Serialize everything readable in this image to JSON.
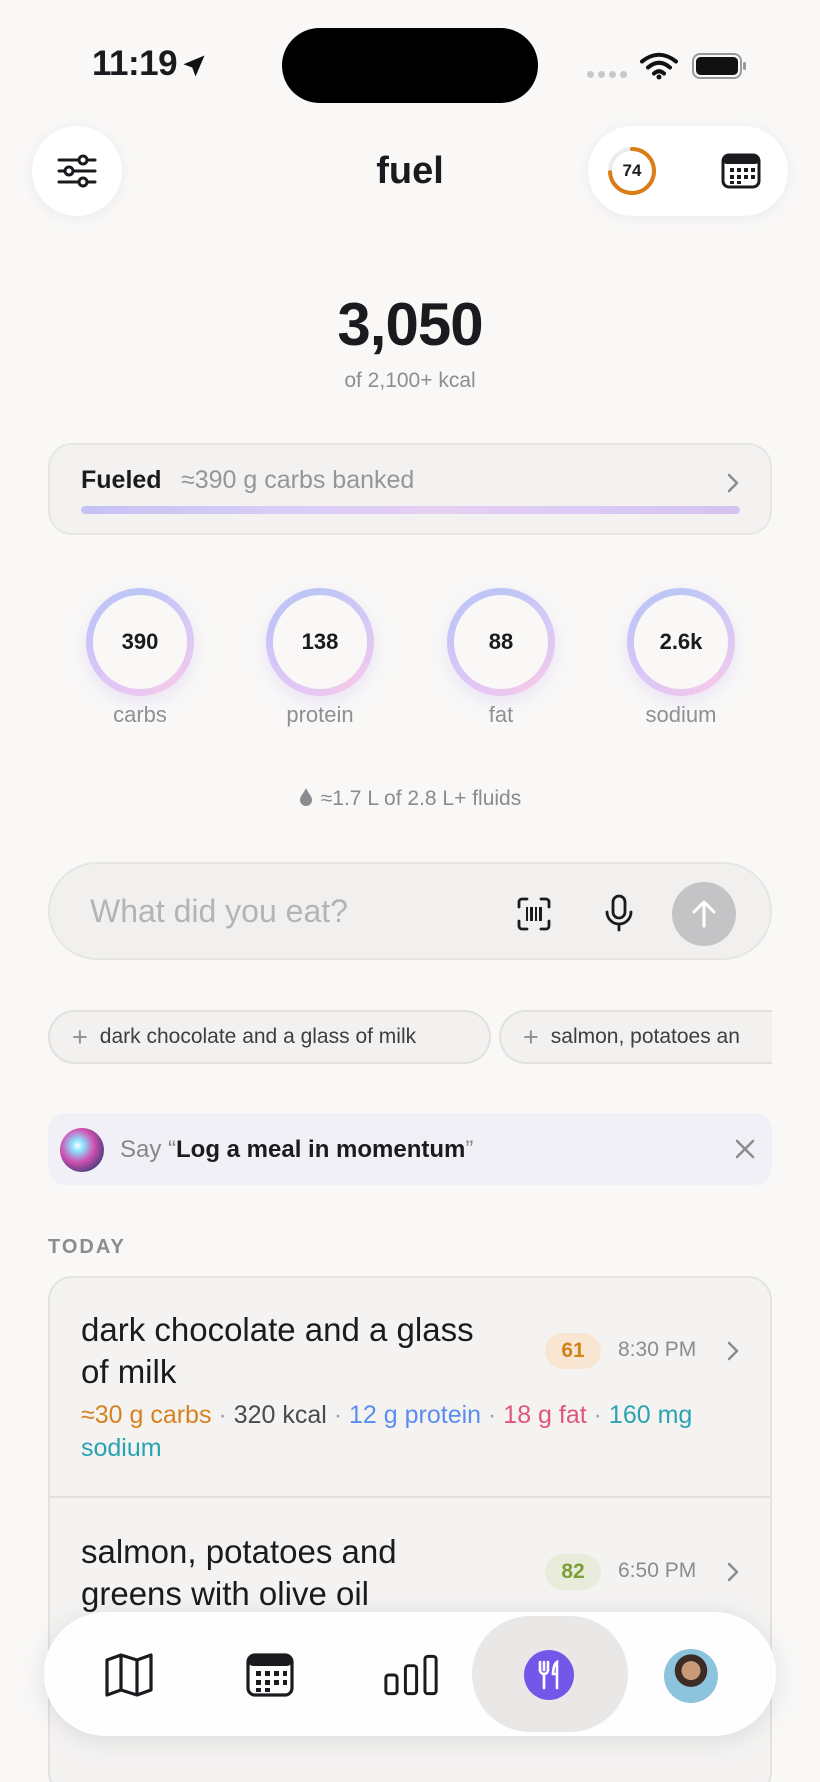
{
  "status": {
    "time": "11:19"
  },
  "header": {
    "title": "fuel",
    "score": "74"
  },
  "kcal": {
    "value": "3,050",
    "target": "of 2,100+ kcal"
  },
  "fuel_card": {
    "label": "Fueled",
    "detail": "≈390 g carbs banked"
  },
  "macros": [
    {
      "value": "390",
      "label": "carbs"
    },
    {
      "value": "138",
      "label": "protein"
    },
    {
      "value": "88",
      "label": "fat"
    },
    {
      "value": "2.6k",
      "label": "sodium"
    }
  ],
  "fluids": "≈1.7 L of 2.8 L+ fluids",
  "input": {
    "placeholder": "What did you eat?"
  },
  "chips": [
    "dark chocolate and a glass of milk",
    "salmon, potatoes an"
  ],
  "siri": {
    "prefix": "Say “",
    "phrase": "Log a meal in momentum",
    "suffix": "”"
  },
  "section": "TODAY",
  "meals": [
    {
      "title": "dark chocolate and a glass of milk",
      "score": "61",
      "time": "8:30 PM",
      "carbs": "≈30 g carbs",
      "kcal": "320 kcal",
      "protein": "12 g protein",
      "fat": "18 g fat",
      "sodium": "160 mg sodium"
    },
    {
      "title": "salmon, potatoes and greens with olive oil",
      "score": "82",
      "time": "6:50 PM"
    }
  ],
  "colors": {
    "accent": "#7257e8",
    "score_ring": "#d97d16"
  },
  "tabs": [
    "map-icon",
    "calendar-icon",
    "bar-chart-icon",
    "fork-knife-icon",
    "avatar"
  ]
}
